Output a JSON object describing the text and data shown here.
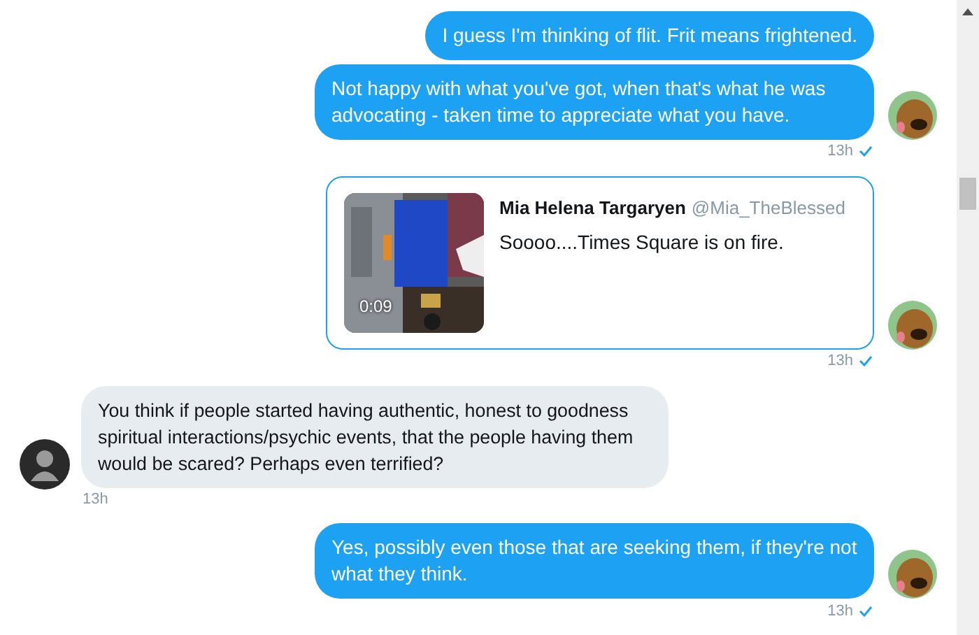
{
  "messages": [
    {
      "kind": "text",
      "outgoing": true,
      "text": "I guess I'm thinking of flit. Frit means frightened."
    },
    {
      "kind": "text",
      "outgoing": true,
      "text": "Not happy with what you've got, when that's what he was advocating - taken time to appreciate what you have.",
      "time": "13h",
      "read": true
    },
    {
      "kind": "tweet",
      "outgoing": true,
      "author": "Mia Helena Targaryen",
      "handle": "@Mia_TheBlessed",
      "text": "Soooo....Times Square is on fire.",
      "video_duration": "0:09",
      "time": "13h",
      "read": true
    },
    {
      "kind": "text",
      "outgoing": false,
      "text": "You think if people started having authentic, honest to goodness spiritual interactions/psychic events, that the people having them would be scared? Perhaps even terrified?",
      "time": "13h"
    },
    {
      "kind": "text",
      "outgoing": true,
      "text": "Yes, possibly even those that are seeking them, if they're not what they think.",
      "time": "13h",
      "read": true
    }
  ]
}
